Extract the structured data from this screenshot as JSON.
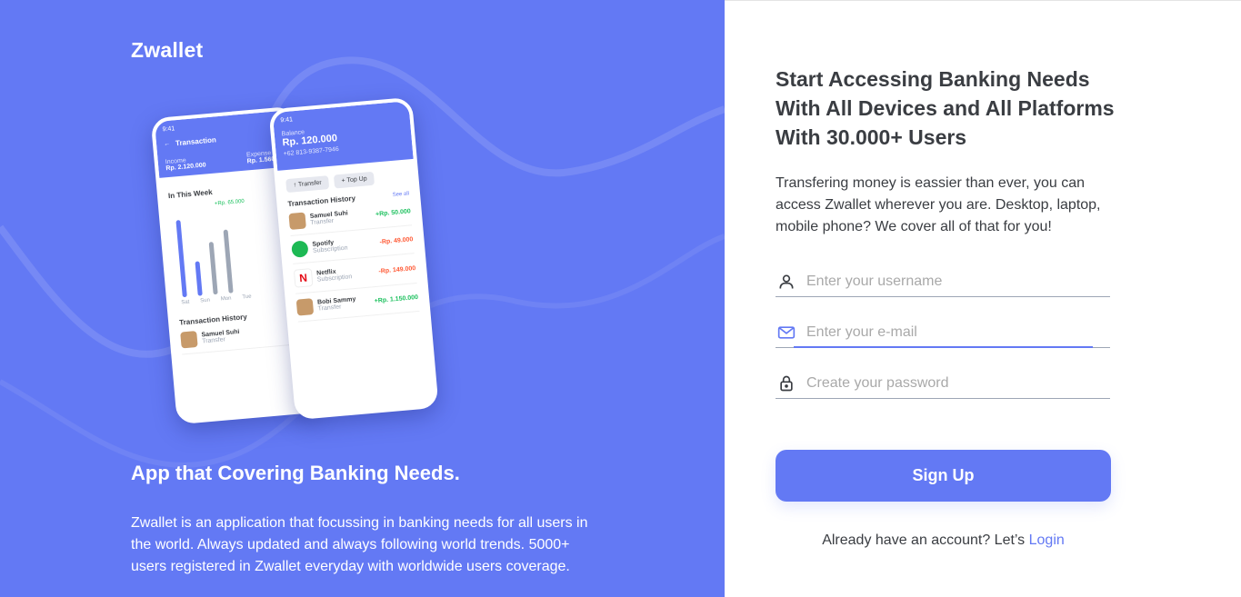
{
  "brand": "Zwallet",
  "left": {
    "heading": "App that Covering Banking Needs.",
    "description": "Zwallet is an application that focussing in banking needs for all users in the world. Always updated and always following world trends. 5000+ users registered in Zwallet everyday with worldwide users coverage."
  },
  "mockup": {
    "phone1": {
      "time": "9:41",
      "title": "Transaction",
      "income_label": "Income",
      "income_value": "Rp. 2.120.000",
      "expense_label": "Expense",
      "expense_value": "Rp. 1.560.000",
      "week_label": "In This Week",
      "tooltip": "+Rp. 65.000",
      "days": [
        "Sat",
        "Sun",
        "Mon",
        "Tue"
      ],
      "history_label": "Transaction History",
      "history_name": "Samuel Suhi",
      "history_sub": "Transfer"
    },
    "phone2": {
      "time": "9:41",
      "balance_label": "Balance",
      "balance_value": "Rp. 120.000",
      "phone_number": "+62 813-9387-7946",
      "transfer_label": "Transfer",
      "topup_label": "Top Up",
      "history_label": "Transaction History",
      "see_all": "See all",
      "transactions": [
        {
          "name": "Samuel Suhi",
          "type": "Transfer",
          "amount": "+Rp. 50.000"
        },
        {
          "name": "Spotify",
          "type": "Subscription",
          "amount": "-Rp. 49.000"
        },
        {
          "name": "Netflix",
          "type": "Subscription",
          "amount": "-Rp. 149.000"
        },
        {
          "name": "Bobi Sammy",
          "type": "Transfer",
          "amount": "+Rp. 1.150.000"
        }
      ]
    }
  },
  "right": {
    "title": "Start Accessing Banking Needs With All Devices and All Platforms With 30.000+ Users",
    "description": "Transfering money is eassier than ever, you can access Zwallet wherever you are. Desktop, laptop, mobile phone? We cover all of that for you!",
    "username_placeholder": "Enter your username",
    "email_placeholder": "Enter your e-mail",
    "password_placeholder": "Create your password",
    "signup_label": "Sign Up",
    "login_prompt": "Already have an account? Let’s",
    "login_link": "Login"
  },
  "colors": {
    "primary": "#6379F4",
    "text": "#3A3D42",
    "positive": "#1EC15F",
    "negative": "#FF5B37"
  },
  "icons": {
    "username": "person-icon",
    "email": "mail-icon",
    "password": "lock-icon"
  }
}
